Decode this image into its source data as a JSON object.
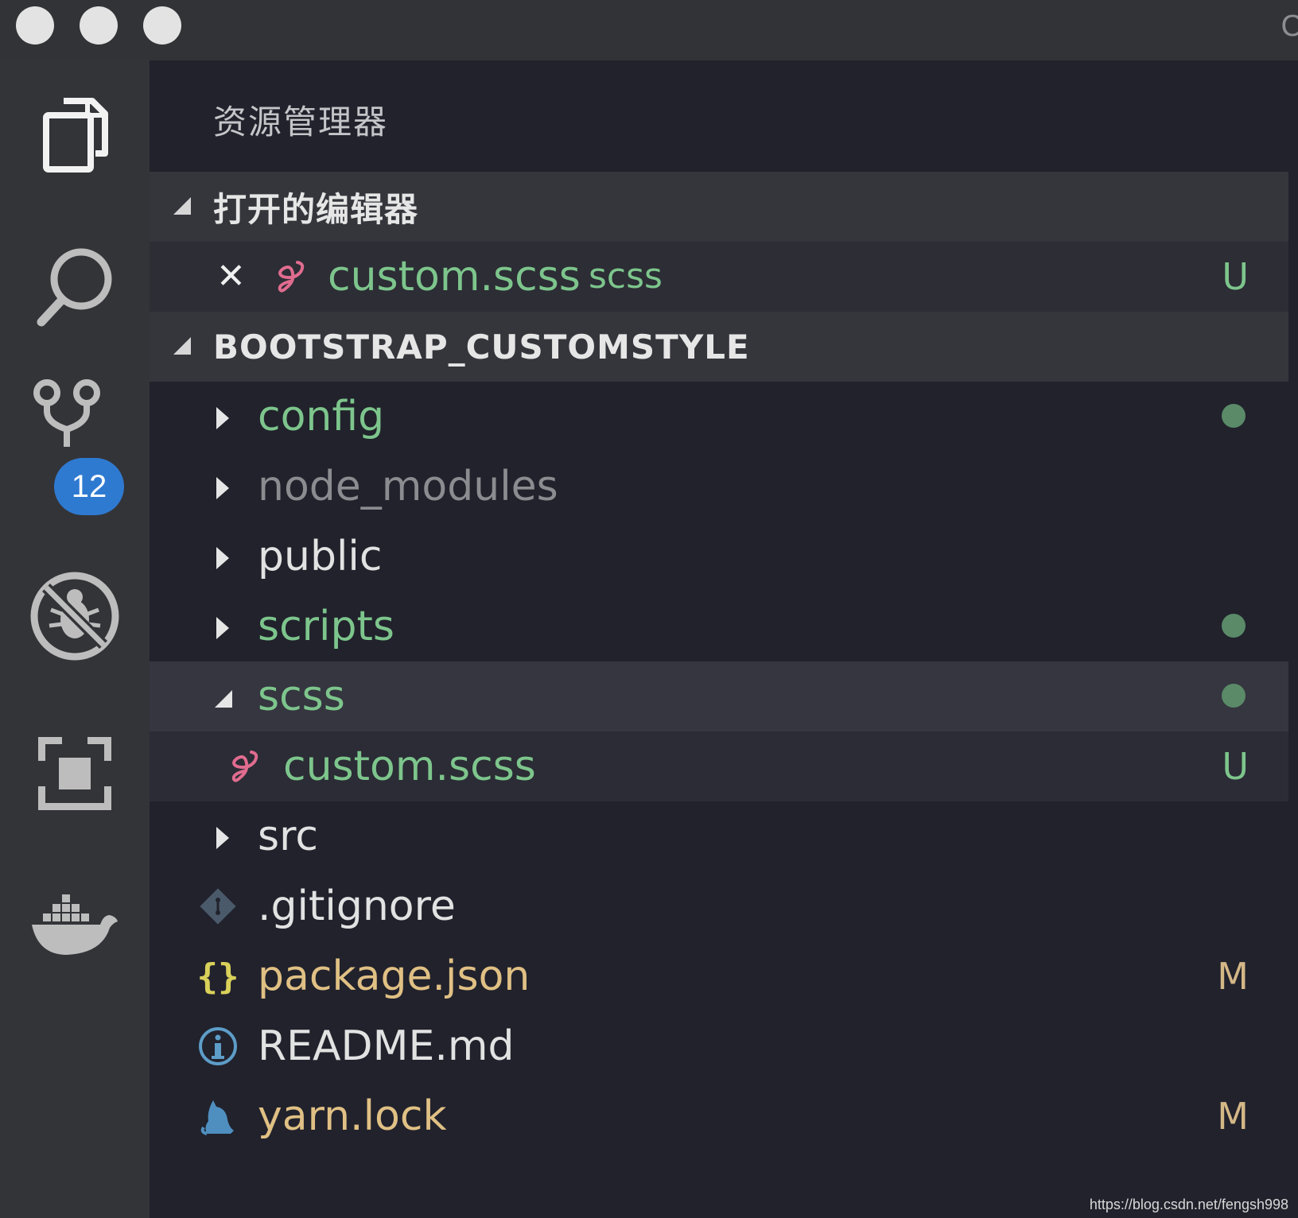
{
  "window": {
    "title_partial": "C"
  },
  "activity_bar": {
    "items": [
      {
        "name": "explorer",
        "icon": "files-icon"
      },
      {
        "name": "search",
        "icon": "search-icon"
      },
      {
        "name": "source-control",
        "icon": "source-control-icon",
        "badge": "12"
      },
      {
        "name": "debug",
        "icon": "debug-disabled-icon"
      },
      {
        "name": "extensions",
        "icon": "extensions-icon"
      },
      {
        "name": "docker",
        "icon": "docker-icon"
      }
    ]
  },
  "sidebar": {
    "title": "资源管理器",
    "open_editors": {
      "label": "打开的编辑器",
      "items": [
        {
          "name": "custom.scss",
          "description": "scss",
          "status": "U",
          "icon": "sass-icon"
        }
      ]
    },
    "project": {
      "label": "BOOTSTRAP_CUSTOMSTYLE",
      "items": [
        {
          "name": "config",
          "type": "folder",
          "status_dot": true
        },
        {
          "name": "node_modules",
          "type": "folder",
          "status_dot": false
        },
        {
          "name": "public",
          "type": "folder",
          "status_dot": false
        },
        {
          "name": "scripts",
          "type": "folder",
          "status_dot": true
        },
        {
          "name": "scss",
          "type": "folder-open",
          "status_dot": true
        },
        {
          "name": "custom.scss",
          "type": "file",
          "status": "U",
          "icon": "sass-icon"
        },
        {
          "name": "src",
          "type": "folder",
          "status_dot": false
        },
        {
          "name": ".gitignore",
          "type": "file",
          "icon": "git-icon"
        },
        {
          "name": "package.json",
          "type": "file",
          "status": "M",
          "icon": "json-braces-icon"
        },
        {
          "name": "README.md",
          "type": "file",
          "icon": "info-icon"
        },
        {
          "name": "yarn.lock",
          "type": "file",
          "status": "M",
          "icon": "yarn-cat-icon"
        }
      ]
    }
  },
  "watermark": "https://blog.csdn.net/fengsh998",
  "colors": {
    "untracked": "#7dc58c",
    "modified": "#e0c084",
    "badge": "#2f7ad1",
    "dot": "#5a8a68"
  }
}
